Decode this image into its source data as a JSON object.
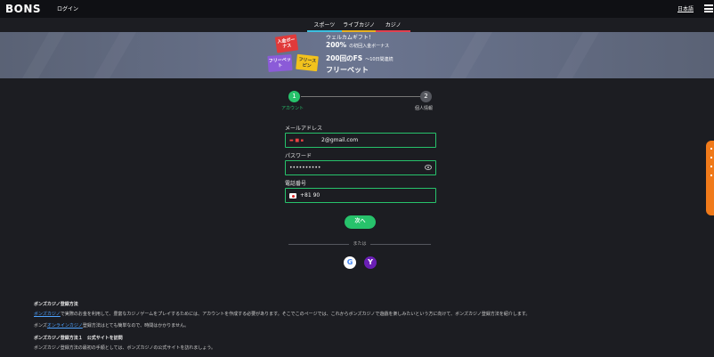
{
  "header": {
    "logo": "BONS",
    "login_label": "ログイン",
    "language_label": "日本語",
    "menu_icon": "hamburger-icon"
  },
  "tabs": [
    {
      "label": "スポーツ"
    },
    {
      "label": "ライブカジノ"
    },
    {
      "label": "カジノ"
    }
  ],
  "banner": {
    "card_deposit": "入金ボーナス",
    "card_freebet": "フリーベット",
    "card_freespin": "フリースピン",
    "welcome_gift": "ウェルカムギフト！",
    "bonus_percent": "200%",
    "bonus_percent_note": "の初回入金ボーナス",
    "fs": "200回のFS",
    "fs_note": "〜10日間連続",
    "freebet": "フリーベット"
  },
  "stepper": {
    "step1_number": "1",
    "step1_label": "アカウント",
    "step2_number": "2",
    "step2_label": "個人情報"
  },
  "form": {
    "email_label": "メールアドレス",
    "email_value": "2@gmail.com",
    "password_label": "パスワード",
    "password_value": "••••••••••",
    "phone_label": "電話番号",
    "phone_value": "+81 90",
    "next_label": "次へ"
  },
  "or_label": "または",
  "social": {
    "google_icon": "google-icon",
    "google_glyph": "G",
    "yahoo_icon": "yahoo-icon",
    "yahoo_glyph": "Y"
  },
  "seo": {
    "h1": "ボンズカジノ登録方法",
    "p1_link": "ボンズカジノ",
    "p1_text": "で実際のお金を利用して、豊富なカジノゲームをプレイするためには、アカウントを作成する必要があります。そこでこのページでは、これからボンズカジノで遊戯を楽しみたいという方に向けて、ボンズカジノ登録方法を紹介します。",
    "p2_pre": "ボンズ",
    "p2_link": "オンラインカジノ",
    "p2_text": "登録方法はとても簡単なので、時間はかかりません。",
    "h2": "ボンズカジノ登録方法１　公式サイトを訪問",
    "p3": "ボンズカジノ登録方法の最初の手順としては、ボンズカジノの公式サイトを訪れましょう。"
  },
  "colors": {
    "accent": "#27c26b",
    "background": "#1c1d22",
    "side_tab": "#f07a1a"
  }
}
